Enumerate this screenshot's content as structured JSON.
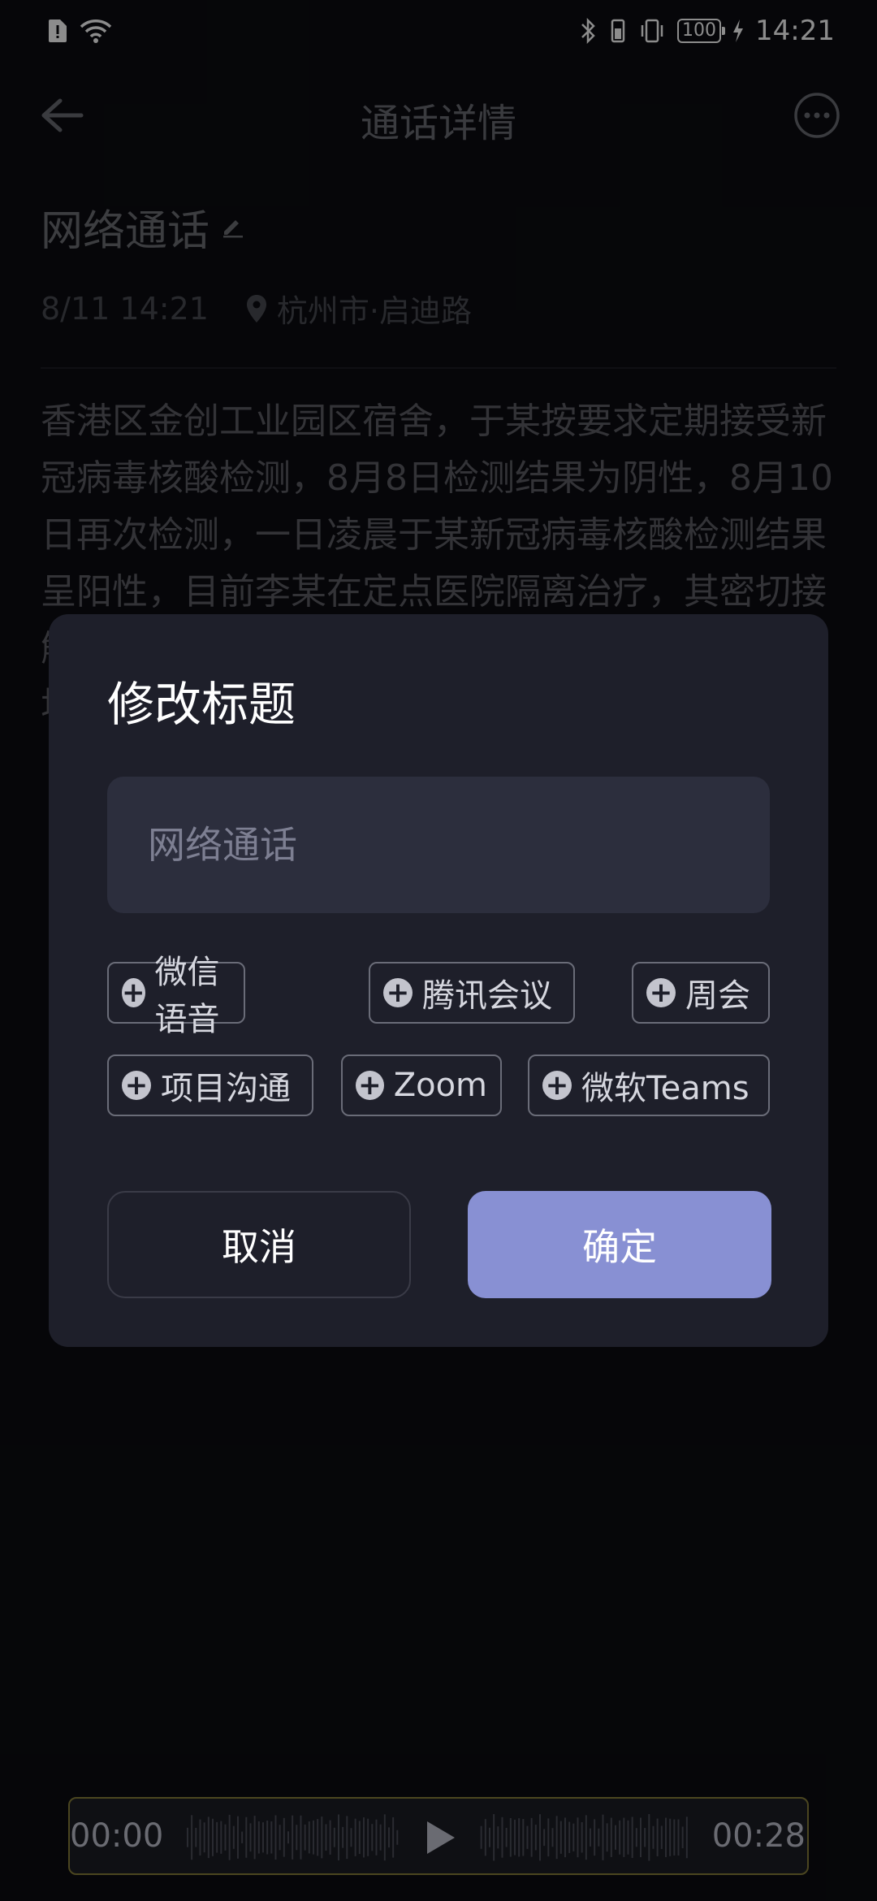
{
  "status_bar": {
    "time": "14:21",
    "battery": "100"
  },
  "header": {
    "title": "通话详情"
  },
  "call": {
    "title": "网络通话",
    "datetime": "8/11 14:21",
    "location": "杭州市·启迪路",
    "transcript": "香港区金创工业园区宿舍，于某按要求定期接受新冠病毒核酸检测，8月8日检测结果为阴性，8月10日再次检测，一日凌晨于某新冠病毒核酸检测结果呈阳性，目前李某在定点医院隔离治疗，其密切接触者已全部按要求进行核酸检测和隔离观察，相关场所已全面消杀。"
  },
  "dialog": {
    "title": "修改标题",
    "input_placeholder": "网络通话",
    "chips": [
      "微信语音",
      "腾讯会议",
      "周会",
      "项目沟通",
      "Zoom",
      "微软Teams"
    ],
    "cancel": "取消",
    "confirm": "确定"
  },
  "player": {
    "current": "00:00",
    "total": "00:28"
  },
  "colors": {
    "accent": "#8890d3",
    "dialog_bg": "#1e1f2a",
    "page_bg": "#0b0c11"
  }
}
